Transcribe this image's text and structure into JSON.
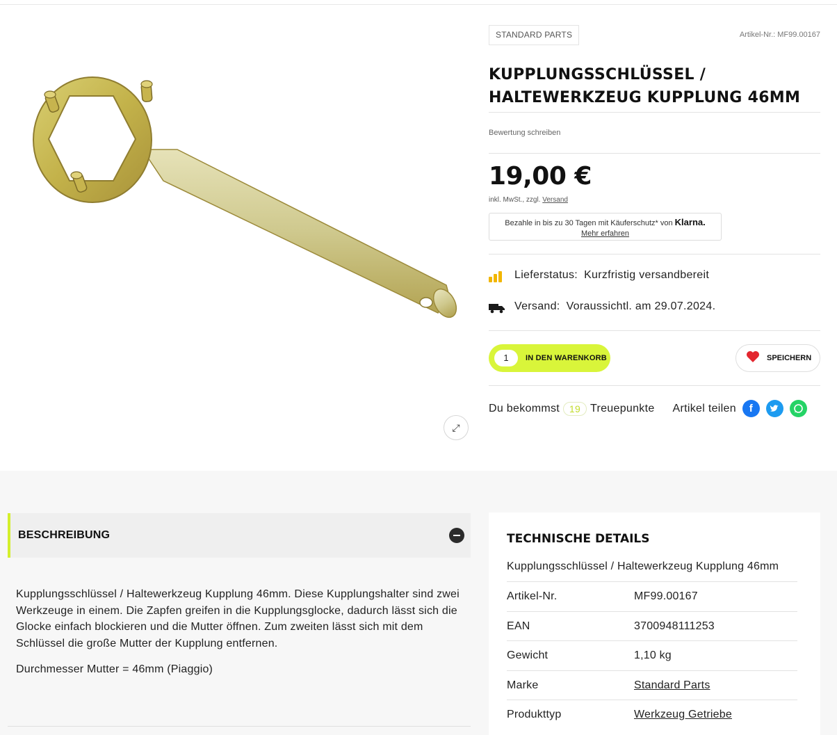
{
  "product": {
    "brand_badge": "STANDARD PARTS",
    "article_number": "Artikel-Nr.: MF99.00167",
    "title": "KUPPLUNGSSCHLÜSSEL / HALTEWERKZEUG KUPPLUNG 46MM",
    "review_link": "Bewertung schreiben",
    "price": "19,00 €",
    "tax_note": "inkl. MwSt., zzgl.",
    "shipping_link": "Versand",
    "klarna": {
      "text": "Bezahle in bis zu 30 Tagen mit Käuferschutz* von",
      "logo": "Klarna.",
      "more": "Mehr erfahren"
    },
    "delivery": {
      "status_label": "Lieferstatus:",
      "status_value": "Kurzfristig versandbereit",
      "shipping_label": "Versand:",
      "shipping_value": "Voraussichtl. am 29.07.2024."
    },
    "cart": {
      "quantity": "1",
      "button_label": "IN DEN WARENKORB"
    },
    "save_label": "SPEICHERN",
    "loyalty": {
      "prefix": "Du bekommst",
      "points": "19",
      "suffix": "Treuepunkte"
    },
    "share_label": "Artikel teilen",
    "share_icons": [
      "facebook-icon",
      "twitter-icon",
      "whatsapp-icon"
    ]
  },
  "description": {
    "heading": "BESCHREIBUNG",
    "paragraph": "Kupplungsschlüssel / Haltewerkzeug Kupplung 46mm. Diese Kupplungshalter sind zwei Werkzeuge in einem. Die Zapfen greifen in die Kupplungsglocke, dadurch lässt sich die Glocke einfach blockieren und die Mutter öffnen. Zum zweiten lässt sich mit dem Schlüssel die große Mutter der Kupplung entfernen.",
    "spec_line": "Durchmesser Mutter = 46mm (Piaggio)"
  },
  "technical_details": {
    "heading": "TECHNISCHE DETAILS",
    "subtitle": "Kupplungsschlüssel / Haltewerkzeug Kupplung 46mm",
    "rows": [
      {
        "key": "Artikel-Nr.",
        "value": "MF99.00167"
      },
      {
        "key": "EAN",
        "value": "3700948111253"
      },
      {
        "key": "Gewicht",
        "value": "1,10 kg"
      },
      {
        "key": "Marke",
        "value": "Standard Parts"
      },
      {
        "key": "Produkttyp",
        "value": "Werkzeug Getriebe"
      }
    ]
  },
  "colors": {
    "accent": "#d9f53a",
    "heart": "#e3262f",
    "facebook": "#1877f2",
    "twitter": "#1d9bf0",
    "whatsapp": "#25d366",
    "status_bars": "#f2b600"
  }
}
